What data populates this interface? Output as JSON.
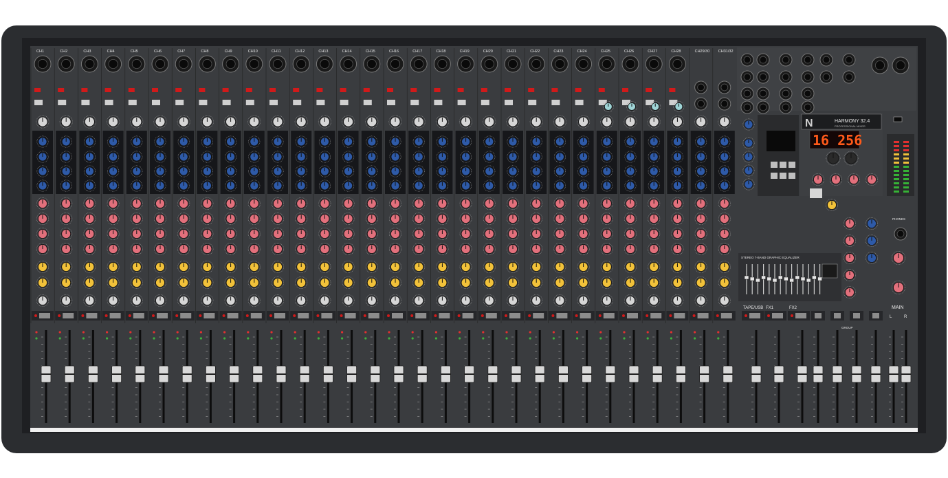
{
  "brand": {
    "model": "HARMONY 32.4",
    "subtitle": "PROFESSIONAL MIXER"
  },
  "display": {
    "digits": "16 256"
  },
  "channels": [
    "CH1",
    "CH2",
    "CH3",
    "CH4",
    "CH5",
    "CH6",
    "CH7",
    "CH8",
    "CH9",
    "CH10",
    "CH11",
    "CH12",
    "CH13",
    "CH14",
    "CH15",
    "CH16",
    "CH17",
    "CH18",
    "CH19",
    "CH20",
    "CH21",
    "CH22",
    "CH23",
    "CH24",
    "CH25",
    "CH26",
    "CH27",
    "CH28",
    "CH29/30",
    "CH31/32"
  ],
  "returns": [
    "TAPE/USB",
    "FX1",
    "FX2"
  ],
  "sections": {
    "master": "MAIN",
    "master_lr": [
      "L",
      "R"
    ],
    "group": "GROUP",
    "geq": "STEREO 7-BAND GRAPHIC EQUALIZER",
    "phones": "PHONES"
  },
  "colors": {
    "panel": "#3b3d40",
    "frame": "#2a2c2f",
    "knob_gain": "#d6d6d6",
    "knob_eq": "#2e5aa8",
    "knob_aux": "#e2707c",
    "knob_fx": "#f2c23a",
    "mute_led": "#d11a1a",
    "display": "#ff5a1a"
  }
}
